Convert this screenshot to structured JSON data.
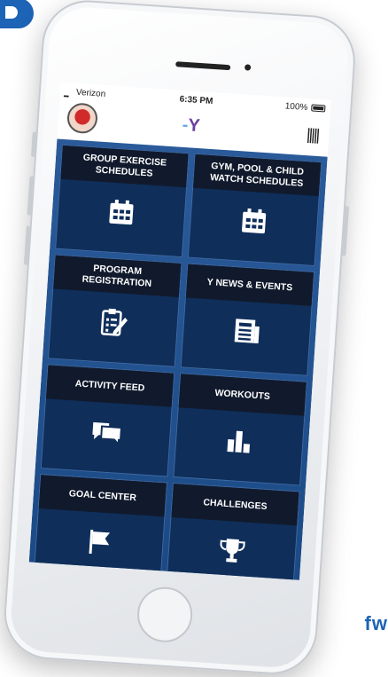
{
  "status_bar": {
    "carrier": "Verizon",
    "time": "6:35 PM",
    "battery": "100%"
  },
  "tiles": [
    {
      "label": "GROUP EXERCISE SCHEDULES",
      "icon": "calendar-icon"
    },
    {
      "label": "GYM, POOL & CHILD WATCH SCHEDULES",
      "icon": "calendar-icon"
    },
    {
      "label": "PROGRAM REGISTRATION",
      "icon": "clipboard-edit-icon"
    },
    {
      "label": "Y NEWS & EVENTS",
      "icon": "newspaper-icon"
    },
    {
      "label": "ACTIVITY FEED",
      "icon": "chat-bubbles-icon"
    },
    {
      "label": "WORKOUTS",
      "icon": "bar-chart-icon"
    },
    {
      "label": "GOAL CENTER",
      "icon": "flag-icon"
    },
    {
      "label": "CHALLENGES",
      "icon": "trophy-icon"
    }
  ],
  "background_text": "fw",
  "colors": {
    "brand_blue": "#1d63b6",
    "tile_bg": "#0f2e5a",
    "tile_header": "#111a2c",
    "grid_bg": "#2a5a9a"
  }
}
